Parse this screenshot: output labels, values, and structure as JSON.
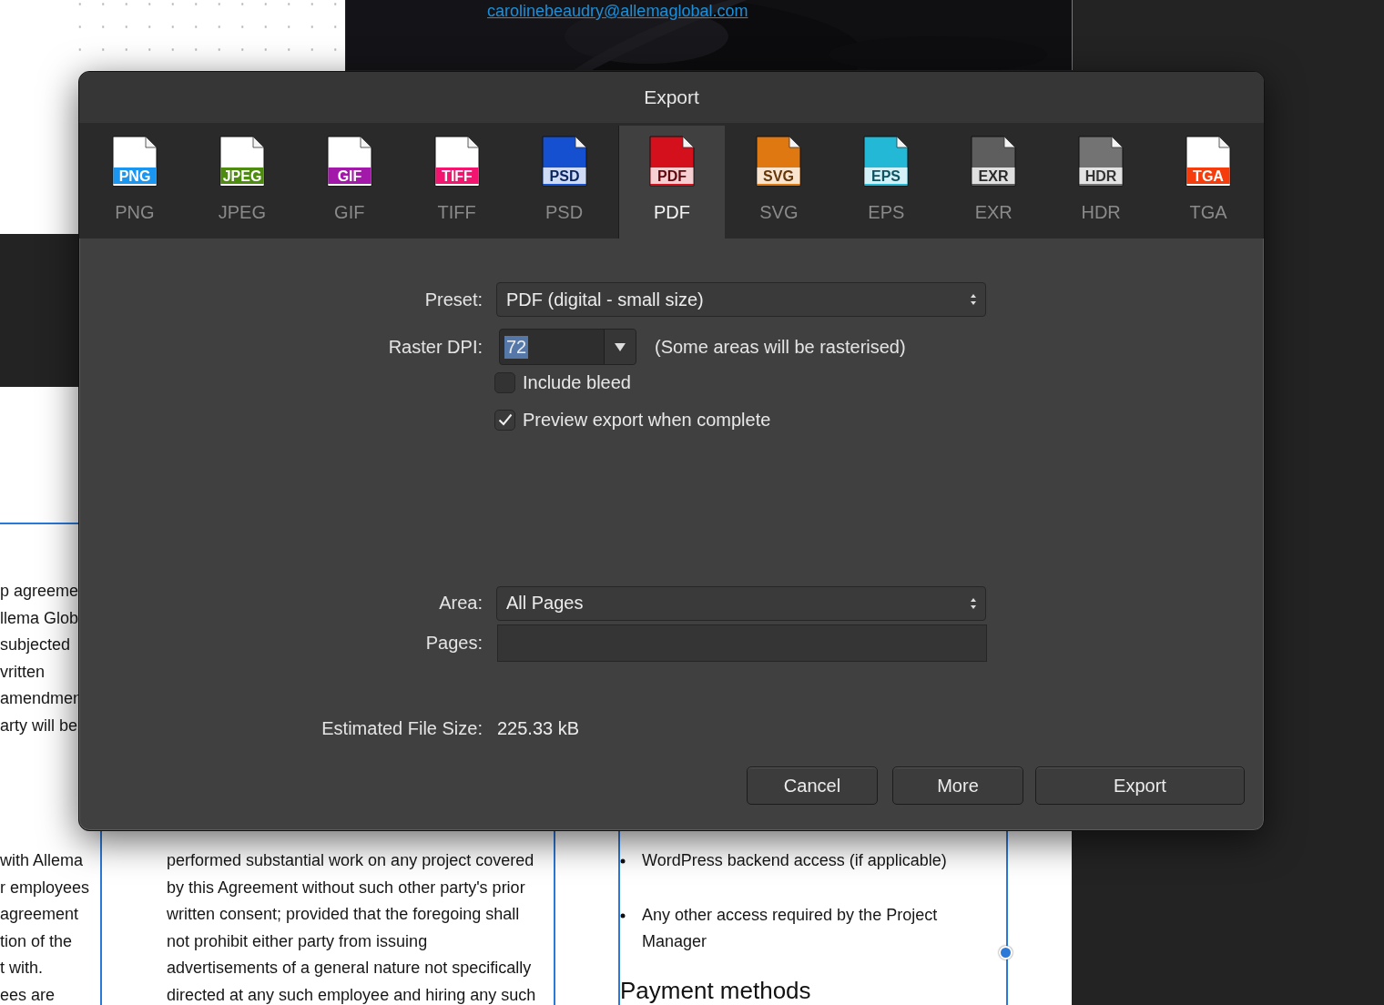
{
  "document": {
    "email": "carolinebeaudry@allemaglobal.com",
    "left_upper_lines": [
      "p agreeme",
      "llema Glob",
      "subjected",
      "vritten",
      "amendmen",
      "arty will be"
    ],
    "left_lower_lines": [
      "with Allema",
      "r employees",
      "agreement",
      "tion of the",
      "t with.",
      "ees are"
    ],
    "middle_lines": [
      "performed substantial work on any project covered",
      "by this Agreement without such other party's prior",
      "written consent; provided that the foregoing shall",
      "not prohibit either party from issuing",
      "advertisements of a general nature not specifically",
      "directed at any such employee and hiring any such"
    ],
    "bullets": [
      "WordPress backend access (if applicable)",
      "Any other access required by the Project Manager"
    ],
    "heading": "Payment methods"
  },
  "dialog": {
    "title": "Export",
    "formats": [
      {
        "label": "PNG",
        "badge": "PNG",
        "kind": "band",
        "color": "#1a96f0",
        "selected": false
      },
      {
        "label": "JPEG",
        "badge": "JPEG",
        "kind": "band",
        "color": "#4e8c10",
        "selected": false
      },
      {
        "label": "GIF",
        "badge": "GIF",
        "kind": "band",
        "color": "#a218a8",
        "selected": false
      },
      {
        "label": "TIFF",
        "badge": "TIFF",
        "kind": "band",
        "color": "#f2146e",
        "selected": false
      },
      {
        "label": "PSD",
        "badge": "PSD",
        "kind": "tinted",
        "color": "#1450d0",
        "selected": false
      },
      {
        "label": "PDF",
        "badge": "PDF",
        "kind": "tinted",
        "color": "#d4101c",
        "selected": true
      },
      {
        "label": "SVG",
        "badge": "SVG",
        "kind": "tinted",
        "color": "#e07812",
        "selected": false
      },
      {
        "label": "EPS",
        "badge": "EPS",
        "kind": "tinted",
        "color": "#22b8d6",
        "selected": false
      },
      {
        "label": "EXR",
        "badge": "EXR",
        "kind": "tinted",
        "color": "#5e5e5e",
        "selected": false
      },
      {
        "label": "HDR",
        "badge": "HDR",
        "kind": "tinted",
        "color": "#737373",
        "selected": false
      },
      {
        "label": "TGA",
        "badge": "TGA",
        "kind": "band",
        "color": "#f43c0c",
        "selected": false
      }
    ],
    "preset": {
      "label": "Preset:",
      "value": "PDF (digital - small size)"
    },
    "raster_dpi": {
      "label": "Raster DPI:",
      "value": "72",
      "text_selected": true,
      "note": "(Some areas will be rasterised)"
    },
    "options": [
      {
        "label": "Include bleed",
        "checked": false
      },
      {
        "label": "Preview export when complete",
        "checked": true
      }
    ],
    "area": {
      "label": "Area:",
      "value": "All Pages"
    },
    "pages": {
      "label": "Pages:"
    },
    "file_size": {
      "label": "Estimated File Size:",
      "value": "225.33 kB"
    },
    "buttons": [
      "Cancel",
      "More",
      "Export"
    ]
  }
}
